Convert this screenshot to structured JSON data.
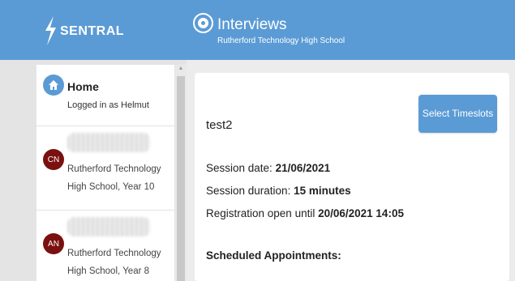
{
  "header": {
    "logo_text": "SENTRAL",
    "module_title": "Interviews",
    "school_name": "Rutherford Technology High School",
    "colors": {
      "bar": "#5b9bd5"
    }
  },
  "sidebar": {
    "home": {
      "icon": "home-icon",
      "title": "Home",
      "subtitle": "Logged in as Helmut"
    },
    "students": [
      {
        "initials": "CN",
        "school": "Rutherford Technology High School, Year 10"
      },
      {
        "initials": "AN",
        "school": "Rutherford Technology High School, Year 8"
      }
    ]
  },
  "main": {
    "session_name": "test2",
    "select_button": "Select Timeslots",
    "session_date_label": "Session date:",
    "session_date": "21/06/2021",
    "session_duration_label": "Session duration:",
    "session_duration": "15 minutes",
    "registration_label": "Registration open until",
    "registration_until": "20/06/2021 14:05",
    "scheduled_heading": "Scheduled Appointments:"
  }
}
